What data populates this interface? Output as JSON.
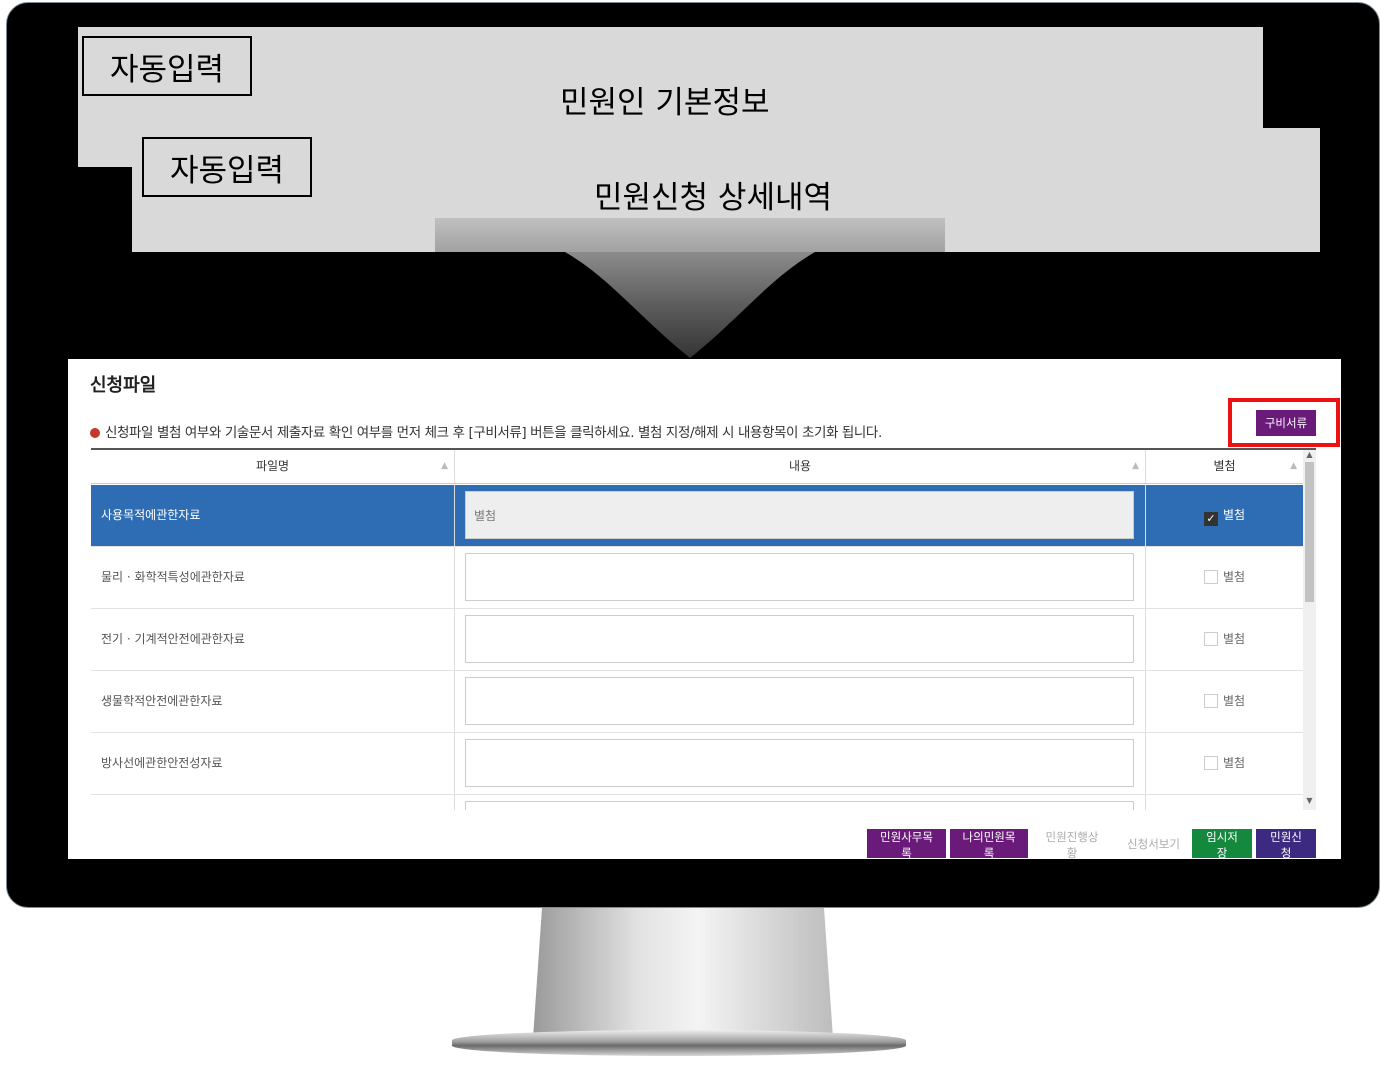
{
  "overlay": {
    "panel1": {
      "tag": "자동입력",
      "title": "민원인 기본정보"
    },
    "panel2": {
      "tag": "자동입력",
      "title": "민원신청 상세내역"
    }
  },
  "screen": {
    "section_title": "신청파일",
    "notice": "신청파일 별첨 여부와 기술문서 제출자료 확인 여부를 먼저 체크 후 [구비서류] 버튼을 클릭하세요. 별첨 지정/해제 시 내용항목이 초기화 됩니다.",
    "gubi_button": "구비서류",
    "table": {
      "columns": [
        "파일명",
        "내용",
        "별첨"
      ],
      "rows": [
        {
          "file": "사용목적에관한자료",
          "content": "별첨",
          "attach_label": "별첨",
          "checked": true,
          "selected": true
        },
        {
          "file": "물리 · 화학적특성에관한자료",
          "content": "",
          "attach_label": "별첨",
          "checked": false,
          "selected": false
        },
        {
          "file": "전기 · 기계적안전에관한자료",
          "content": "",
          "attach_label": "별첨",
          "checked": false,
          "selected": false
        },
        {
          "file": "생물학적안전에관한자료",
          "content": "",
          "attach_label": "별첨",
          "checked": false,
          "selected": false
        },
        {
          "file": "방사선에관한안전성자료",
          "content": "",
          "attach_label": "별첨",
          "checked": false,
          "selected": false
        }
      ]
    },
    "buttons": {
      "office_list": "민원사무목록",
      "my_list": "나의민원목록",
      "progress": "민원진행상황",
      "view_form": "신청서보기",
      "temp_save": "임시저장",
      "apply": "민원신청"
    }
  },
  "colors": {
    "highlight": "#ee1111",
    "purple_button": "#6a1b7a",
    "green_button": "#14893e",
    "navy_button": "#3c2a80",
    "selected_row": "#2e6db4"
  }
}
